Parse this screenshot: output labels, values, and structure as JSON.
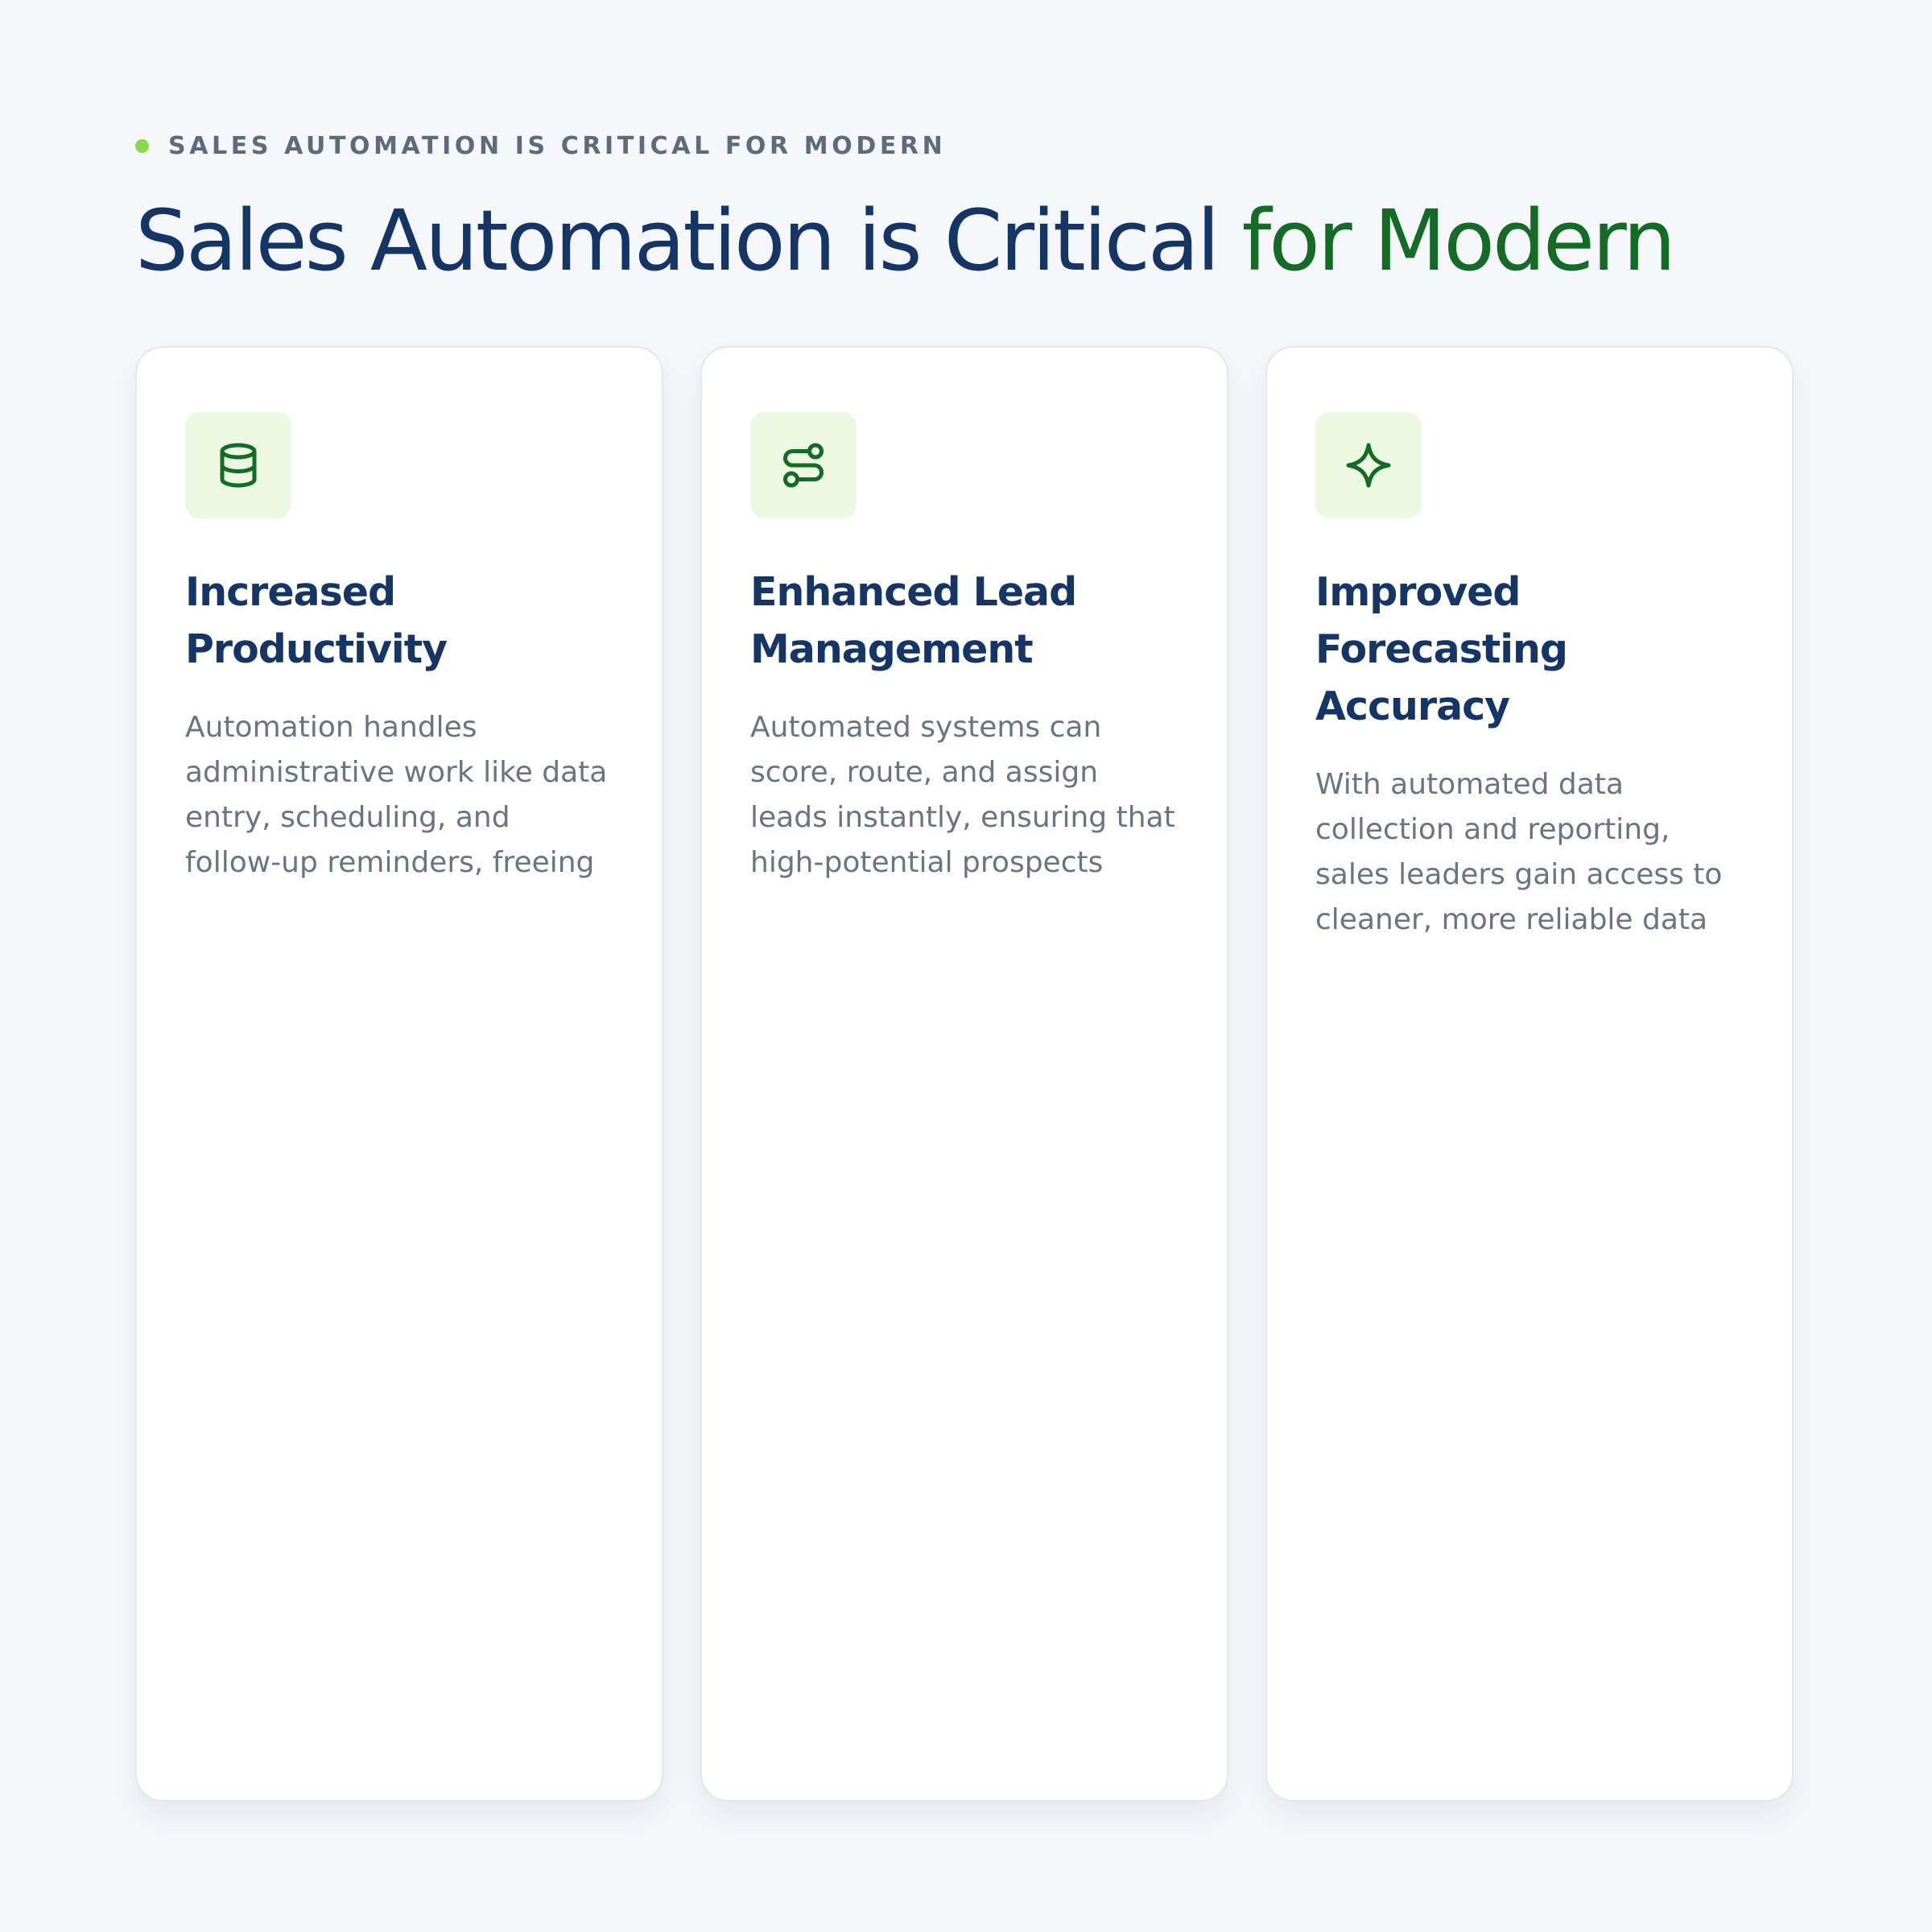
{
  "colors": {
    "background": "#f5f7fa",
    "heading": "#153566",
    "accent": "#136b26",
    "dot": "#8bd84a",
    "muted": "#6a7482",
    "icon_bg": "#ecf8e2"
  },
  "header": {
    "eyebrow": "SALES AUTOMATION IS CRITICAL FOR MODERN",
    "title_main": "Sales Automation is Critical ",
    "title_accent": "for Modern"
  },
  "cards": [
    {
      "icon": "database-icon",
      "title": "Increased Productivity",
      "body": "Automation handles administrative work like data entry, scheduling, and follow-up reminders, freeing up sales..."
    },
    {
      "icon": "route-icon",
      "title": "Enhanced Lead Management",
      "body": "Automated systems can score, route, and assign leads instantly, ensuring that high-potential prospects receive..."
    },
    {
      "icon": "sparkle-icon",
      "title": "Improved Forecasting Accuracy",
      "body": "With automated data collection and reporting, sales leaders gain access to cleaner, more reliable data for more precise..."
    }
  ]
}
